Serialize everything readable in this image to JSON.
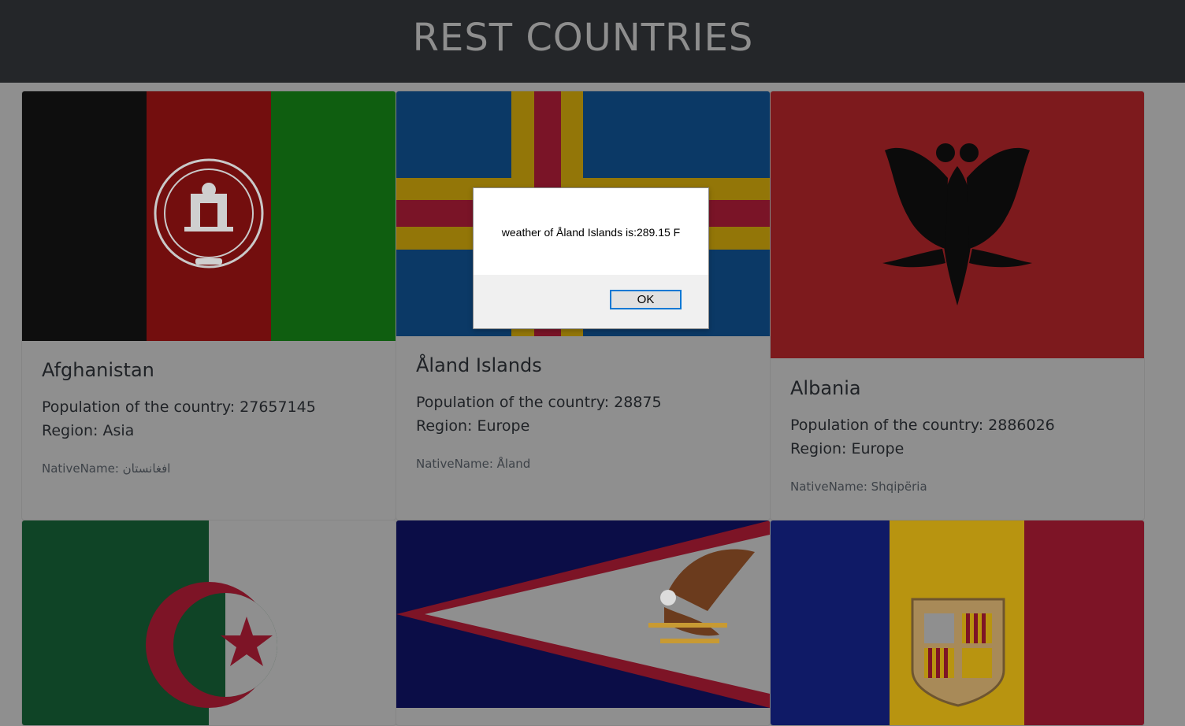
{
  "header": {
    "title": "REST COUNTRIES"
  },
  "countries": [
    {
      "name": "Afghanistan",
      "population_label": "Population of the country: 27657145",
      "region_label": "Region: Asia",
      "native_label": "NativeName: افغانستان"
    },
    {
      "name": "Åland Islands",
      "population_label": "Population of the country: 28875",
      "region_label": "Region: Europe",
      "native_label": "NativeName: Åland"
    },
    {
      "name": "Albania",
      "population_label": "Population of the country: 2886026",
      "region_label": "Region: Europe",
      "native_label": "NativeName: Shqipëria"
    }
  ],
  "flags": [
    "afghanistan-flag",
    "aland-islands-flag",
    "albania-flag",
    "algeria-flag",
    "american-samoa-flag",
    "andorra-flag"
  ],
  "dialog": {
    "message": "weather of Åland Islands is:289.15 F",
    "ok_label": "OK"
  }
}
